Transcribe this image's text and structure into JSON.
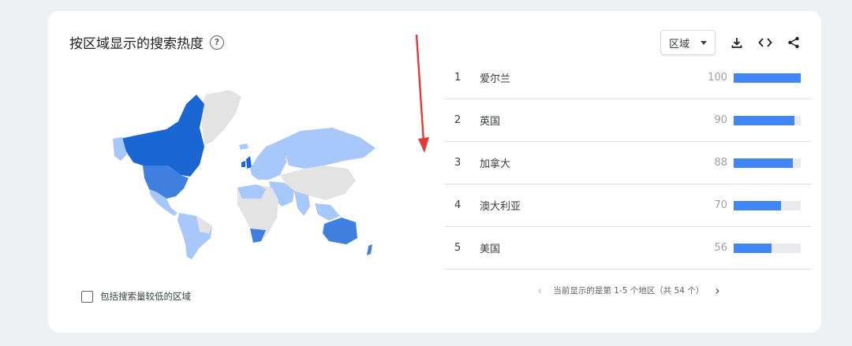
{
  "header": {
    "title": "按区域显示的搜索热度",
    "help_icon": "help-icon"
  },
  "toolbar": {
    "region_label": "区域",
    "icons": [
      "download-icon",
      "embed-code-icon",
      "share-icon"
    ]
  },
  "map": {
    "colors": {
      "strong": "#1a66d2",
      "medium": "#3f7fe0",
      "light": "#a8c7fa",
      "none": "#e3e3e3"
    }
  },
  "options": {
    "include_low_volume_label": "包括搜索量较低的区域"
  },
  "rankings": [
    {
      "rank": "1",
      "name": "爱尔兰",
      "value": 100
    },
    {
      "rank": "2",
      "name": "英国",
      "value": 90
    },
    {
      "rank": "3",
      "name": "加拿大",
      "value": 88
    },
    {
      "rank": "4",
      "name": "澳大利亚",
      "value": 70
    },
    {
      "rank": "5",
      "name": "美国",
      "value": 56
    }
  ],
  "pager": {
    "text": "当前显示的是第 1-5 个地区（共 54 个）"
  },
  "accent_color": "#4285f4",
  "annotation_color": "#e53935"
}
